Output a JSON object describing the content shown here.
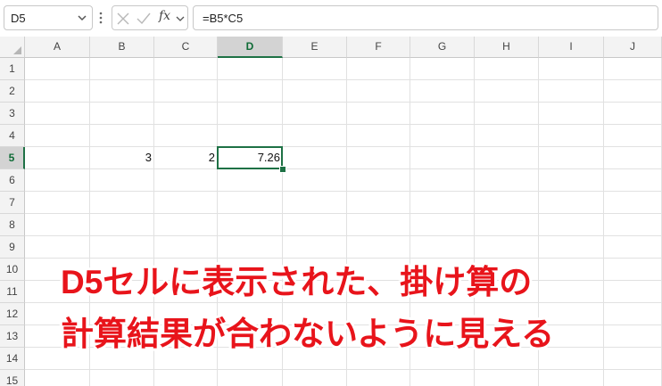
{
  "formula_bar": {
    "name_box": "D5",
    "formula": "=B5*C5",
    "fx_label": "fx"
  },
  "columns": [
    "A",
    "B",
    "C",
    "D",
    "E",
    "F",
    "G",
    "H",
    "I",
    "J"
  ],
  "rows": [
    "1",
    "2",
    "3",
    "4",
    "5",
    "6",
    "7",
    "8",
    "9",
    "10",
    "11",
    "12",
    "13",
    "14",
    "15"
  ],
  "selected_cell": "D5",
  "cells": {
    "B5": "3",
    "C5": "2",
    "D5": "7.26"
  },
  "annotation": {
    "line1": "D5セルに表示された、掛け算の",
    "line2": "計算結果が合わないように見える",
    "color": "#e8141b"
  },
  "colors": {
    "accent": "#1e7145",
    "header_bg": "#f3f3f3",
    "gridline": "#e1e1e1"
  }
}
